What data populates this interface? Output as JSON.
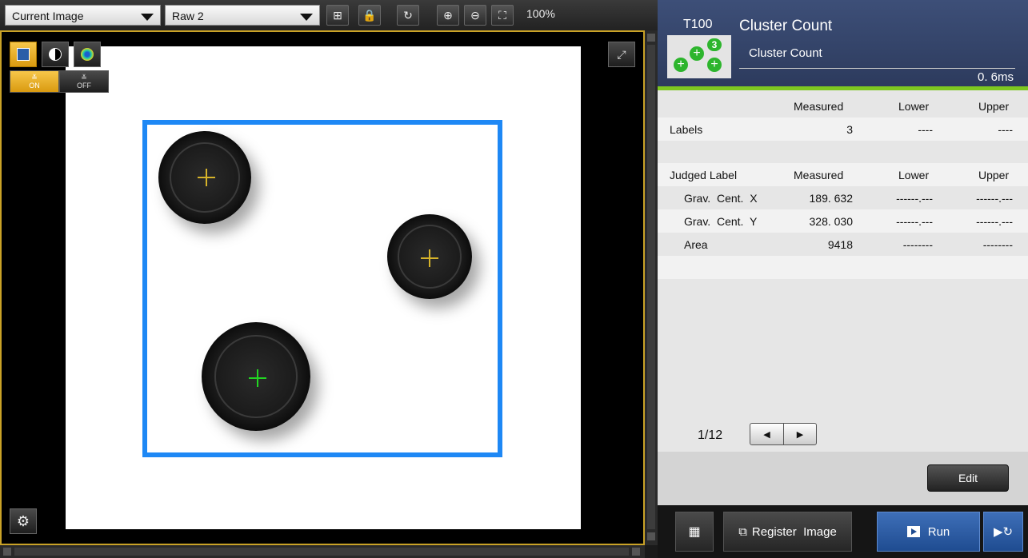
{
  "toolbar": {
    "image_select": "Current Image",
    "camera_select": "Raw 2",
    "zoom": "100%"
  },
  "viewer": {
    "switch_on": "ON",
    "switch_off": "OFF"
  },
  "tool": {
    "id": "T100",
    "title": "Cluster Count",
    "subtitle": "Cluster Count",
    "time": "0. 6ms",
    "badge": "3"
  },
  "results": {
    "headers": {
      "measured": "Measured",
      "lower": "Lower",
      "upper": "Upper"
    },
    "labels_row": {
      "label": "Labels",
      "measured": "3",
      "lower": "----",
      "upper": "----"
    },
    "judged_header": "Judged Label",
    "rows": [
      {
        "label": "Grav.  Cent.  X",
        "measured": "189. 632",
        "lower": "------.---",
        "upper": "------.---"
      },
      {
        "label": "Grav.  Cent.  Y",
        "measured": "328. 030",
        "lower": "------.---",
        "upper": "------.---"
      },
      {
        "label": "Area",
        "measured": "9418",
        "lower": "--------",
        "upper": "--------"
      }
    ]
  },
  "pager": {
    "page": "1/12"
  },
  "buttons": {
    "edit": "Edit",
    "register": "Register  Image",
    "run": "Run"
  },
  "colors": {
    "roi": "#1e88f5",
    "accent": "#c9a227",
    "status_green": "#7ec820"
  }
}
